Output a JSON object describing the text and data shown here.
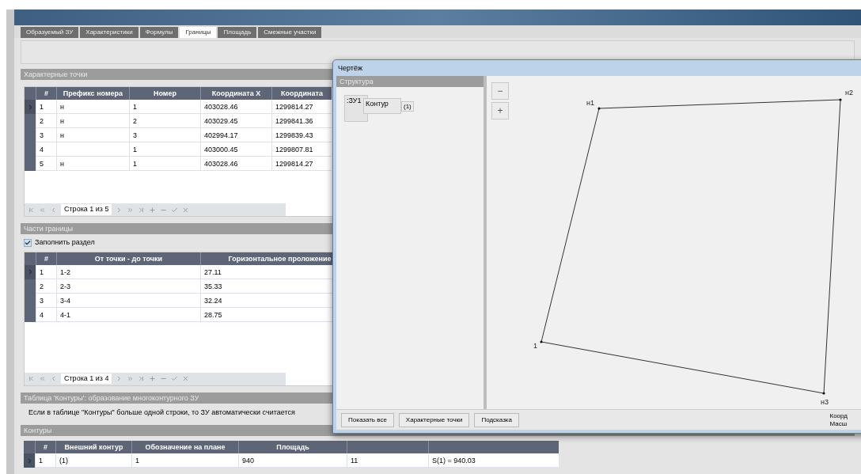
{
  "tabs": [
    {
      "label": "Образуемый ЗУ",
      "selected": false
    },
    {
      "label": "Характеристики",
      "selected": false
    },
    {
      "label": "Формулы",
      "selected": false
    },
    {
      "label": "Границы",
      "selected": true
    },
    {
      "label": "Площадь",
      "selected": false
    },
    {
      "label": "Смежные участки",
      "selected": false
    }
  ],
  "points_section": {
    "title": "Характерные точки",
    "columns": [
      "#",
      "Префикс номера",
      "Номер",
      "Координата X",
      "Координата"
    ],
    "rows": [
      {
        "selected": true,
        "cells": [
          "1",
          "н",
          "1",
          "403028.46",
          "1299814.27"
        ]
      },
      {
        "selected": false,
        "cells": [
          "2",
          "н",
          "2",
          "403029.45",
          "1299841.36"
        ]
      },
      {
        "selected": false,
        "cells": [
          "3",
          "н",
          "3",
          "402994.17",
          "1299839.43"
        ]
      },
      {
        "selected": false,
        "cells": [
          "4",
          "",
          "1",
          "403000.45",
          "1299807.81"
        ]
      },
      {
        "selected": false,
        "cells": [
          "5",
          "н",
          "1",
          "403028.46",
          "1299814.27"
        ]
      }
    ],
    "pager": "Строка 1 из 5"
  },
  "boundary_section": {
    "title": "Части границы",
    "fill_checkbox": {
      "label": "Заполнить раздел",
      "checked": true
    },
    "columns": [
      "#",
      "От точки - до точки",
      "Горизонтальное проложение"
    ],
    "rows": [
      {
        "selected": true,
        "cells": [
          "1",
          "1-2",
          "27.11"
        ]
      },
      {
        "selected": false,
        "cells": [
          "2",
          "2-3",
          "35.33"
        ]
      },
      {
        "selected": false,
        "cells": [
          "3",
          "3-4",
          "32.24"
        ]
      },
      {
        "selected": false,
        "cells": [
          "4",
          "4-1",
          "28.75"
        ]
      }
    ],
    "pager": "Строка 1 из 4"
  },
  "contours_info": {
    "title": "Таблица 'Контуры': образование многоконтурного ЗУ",
    "text": "Если в таблице \"Контуры\" больше одной строки, то ЗУ автоматически считается"
  },
  "contours": {
    "title": "Контуры",
    "columns": [
      "#",
      "Внешний контур",
      "Обозначение на плане",
      "Площадь",
      "",
      ""
    ],
    "rows": [
      {
        "selected": true,
        "cells": [
          "1",
          "(1)",
          "1",
          "940",
          "11",
          "S(1) = 940.03"
        ]
      }
    ]
  },
  "drawing_dialog": {
    "title": "Чертёж",
    "structure_title": "Структура",
    "tree": {
      "label": ":ЗУ1",
      "children": [
        {
          "label": "Контур",
          "children": [
            {
              "label": "(1)"
            }
          ]
        }
      ]
    },
    "zoom_buttons": [
      "−",
      "+"
    ],
    "points": [
      "н1",
      "н2",
      "н3",
      "1"
    ],
    "buttons": [
      "Показать все",
      "Характерные точки",
      "Подсказка"
    ],
    "status": [
      "Коорд",
      "Масш"
    ]
  }
}
